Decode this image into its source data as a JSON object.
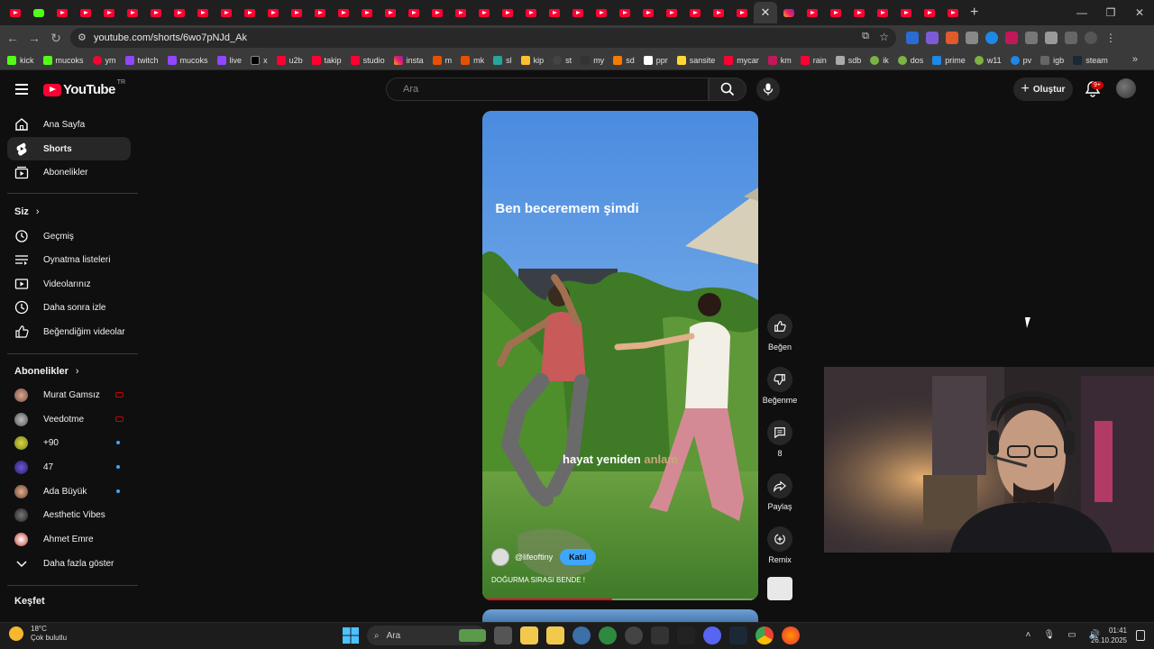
{
  "browser": {
    "url": "youtube.com/shorts/6wo7pNJd_Ak",
    "bookmarks": [
      "kick",
      "mucoks",
      "ym",
      "twitch",
      "mucoks",
      "live",
      "x",
      "u2b",
      "takip",
      "studio",
      "insta",
      "m",
      "mk",
      "sl",
      "kip",
      "st",
      "my",
      "sd",
      "ppr",
      "sansite",
      "mycar",
      "km",
      "rain",
      "sdb",
      "ik",
      "dos",
      "prime",
      "w11",
      "pv",
      "igb",
      "steam"
    ]
  },
  "header": {
    "logo": "YouTube",
    "region": "TR",
    "search_placeholder": "Ara",
    "create_label": "Oluştur",
    "notif_count": "9+"
  },
  "sidebar": {
    "main": [
      "Ana Sayfa",
      "Shorts",
      "Abonelikler"
    ],
    "you_title": "Siz",
    "you": [
      "Geçmiş",
      "Oynatma listeleri",
      "Videolarınız",
      "Daha sonra izle",
      "Beğendiğim videolar"
    ],
    "subs_title": "Abonelikler",
    "subs": [
      "Murat Gamsız",
      "Veedotme",
      "+90",
      "47",
      "Ada Büyük",
      "Aesthetic Vibes",
      "Ahmet Emre"
    ],
    "more": "Daha fazla göster",
    "explore_title": "Keşfet"
  },
  "short": {
    "caption_top": "Ben beceremem şimdi",
    "caption_sub_main": "hayat yeniden",
    "caption_sub_fade": "anlam",
    "channel": "@lifeoftiny",
    "join": "Katıl",
    "title": "DOĞURMA SIRASI BENDE !",
    "progress": 0.47
  },
  "actions": {
    "like": "Beğen",
    "dislike": "Beğenme",
    "comments": "8",
    "share": "Paylaş",
    "remix": "Remix"
  },
  "taskbar": {
    "temp": "18°C",
    "weather": "Çok bulutlu",
    "search": "Ara",
    "time": "01:41",
    "date": "26.10.2025"
  }
}
